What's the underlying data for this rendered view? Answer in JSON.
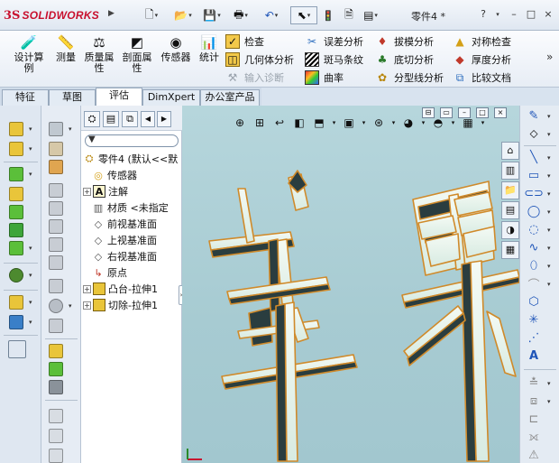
{
  "app": {
    "logo_prefix": "3S",
    "logo_name": "SOLIDWORKS",
    "document_title": "零件4 *"
  },
  "window_controls": {
    "help": "?",
    "minimize": "–",
    "restore": "□",
    "close": "×"
  },
  "quick_access": {
    "new": "🗋",
    "open": "📂",
    "save": "💾",
    "print": "🖶",
    "undo": "↶",
    "select": "⬉",
    "rebuild": "🚦",
    "options": "▤"
  },
  "ribbon": {
    "big_buttons": [
      {
        "label": "设计算\n例",
        "icon": "design-study-icon"
      },
      {
        "label": "测量",
        "icon": "measure-icon"
      },
      {
        "label": "质量属\n性",
        "icon": "mass-properties-icon"
      },
      {
        "label": "剖面属\n性",
        "icon": "section-properties-icon"
      },
      {
        "label": "传感器",
        "icon": "sensor-icon"
      },
      {
        "label": "统计",
        "icon": "statistics-icon"
      }
    ],
    "small_buttons": [
      {
        "label": "检查",
        "icon": "check-icon",
        "enabled": true
      },
      {
        "label": "几何体分析",
        "icon": "geometry-analysis-icon",
        "enabled": true
      },
      {
        "label": "输入诊断",
        "icon": "import-diagnostics-icon",
        "enabled": false
      },
      {
        "label": "误差分析",
        "icon": "deviation-analysis-icon",
        "enabled": true
      },
      {
        "label": "斑马条纹",
        "icon": "zebra-stripes-icon",
        "enabled": true
      },
      {
        "label": "曲率",
        "icon": "curvature-icon",
        "enabled": true
      },
      {
        "label": "拔模分析",
        "icon": "draft-analysis-icon",
        "enabled": true
      },
      {
        "label": "底切分析",
        "icon": "undercut-analysis-icon",
        "enabled": true
      },
      {
        "label": "分型线分析",
        "icon": "parting-line-analysis-icon",
        "enabled": true
      },
      {
        "label": "对称检查",
        "icon": "symmetry-check-icon",
        "enabled": true
      },
      {
        "label": "厚度分析",
        "icon": "thickness-analysis-icon",
        "enabled": true
      },
      {
        "label": "比较文档",
        "icon": "compare-documents-icon",
        "enabled": true
      }
    ],
    "more": "»"
  },
  "tabs": [
    {
      "label": "特征",
      "active": false
    },
    {
      "label": "草图",
      "active": false
    },
    {
      "label": "评估",
      "active": true
    },
    {
      "label": "DimXpert",
      "active": false
    },
    {
      "label": "办公室产品",
      "active": false
    }
  ],
  "feature_tree": {
    "filter_glyph": "▼",
    "items": [
      {
        "label": "零件4 (默认<<默",
        "icon": "part-icon",
        "expand": ""
      },
      {
        "label": "传感器",
        "icon": "sensor-folder-icon",
        "expand": ""
      },
      {
        "label": "注解",
        "icon": "annotations-icon",
        "expand": "+"
      },
      {
        "label": "材质 <未指定",
        "icon": "material-icon",
        "expand": ""
      },
      {
        "label": "前视基准面",
        "icon": "plane-icon",
        "expand": ""
      },
      {
        "label": "上视基准面",
        "icon": "plane-icon",
        "expand": ""
      },
      {
        "label": "右视基准面",
        "icon": "plane-icon",
        "expand": ""
      },
      {
        "label": "原点",
        "icon": "origin-icon",
        "expand": ""
      },
      {
        "label": "凸台-拉伸1",
        "icon": "extrude-boss-icon",
        "expand": "+"
      },
      {
        "label": "切除-拉伸1",
        "icon": "extrude-cut-icon",
        "expand": "+"
      }
    ]
  },
  "colors": {
    "viewport_bg": "#a9ccd3",
    "model_fill": "#eef5ee",
    "model_edge": "#d08a2a",
    "model_shadow": "#2a3d3f",
    "accent_red": "#c8102e"
  }
}
